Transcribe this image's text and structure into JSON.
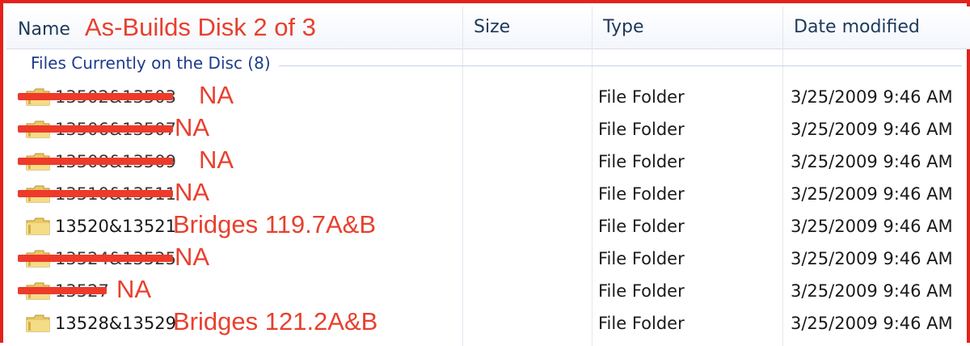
{
  "columns": {
    "name": "Name",
    "size": "Size",
    "type": "Type",
    "date": "Date modified"
  },
  "header_annotation": "As-Builds Disk 2 of 3",
  "group": {
    "label": "Files Currently on the Disc (8)"
  },
  "rows": [
    {
      "name": "13502&13503",
      "struck": true,
      "note": "NA",
      "type": "File Folder",
      "date": "3/25/2009 9:46 AM",
      "icon": "folder-icon"
    },
    {
      "name": "13506&13507",
      "struck": true,
      "note": "NA",
      "type": "File Folder",
      "date": "3/25/2009 9:46 AM",
      "icon": "folder-icon"
    },
    {
      "name": "13508&13509",
      "struck": true,
      "note": "NA",
      "type": "File Folder",
      "date": "3/25/2009 9:46 AM",
      "icon": "folder-icon"
    },
    {
      "name": "13510&13511",
      "struck": true,
      "note": "NA",
      "type": "File Folder",
      "date": "3/25/2009 9:46 AM",
      "icon": "folder-icon"
    },
    {
      "name": "13520&13521",
      "struck": false,
      "note": "Bridges 119.7A&B",
      "type": "File Folder",
      "date": "3/25/2009 9:46 AM",
      "icon": "folder-icon"
    },
    {
      "name": "13524&13525",
      "struck": true,
      "note": "NA",
      "type": "File Folder",
      "date": "3/25/2009 9:46 AM",
      "icon": "folder-icon"
    },
    {
      "name": "13527",
      "struck": true,
      "note": "NA",
      "type": "File Folder",
      "date": "3/25/2009 9:46 AM",
      "icon": "folder-icon"
    },
    {
      "name": "13528&13529",
      "struck": false,
      "note": "Bridges 121.2A&B",
      "type": "File Folder",
      "date": "3/25/2009 9:46 AM",
      "icon": "folder-icon"
    }
  ],
  "colors": {
    "annotation": "#e8402e",
    "frame": "#e3221b",
    "group_label": "#1e3c8c",
    "header_text": "#1e395b"
  }
}
